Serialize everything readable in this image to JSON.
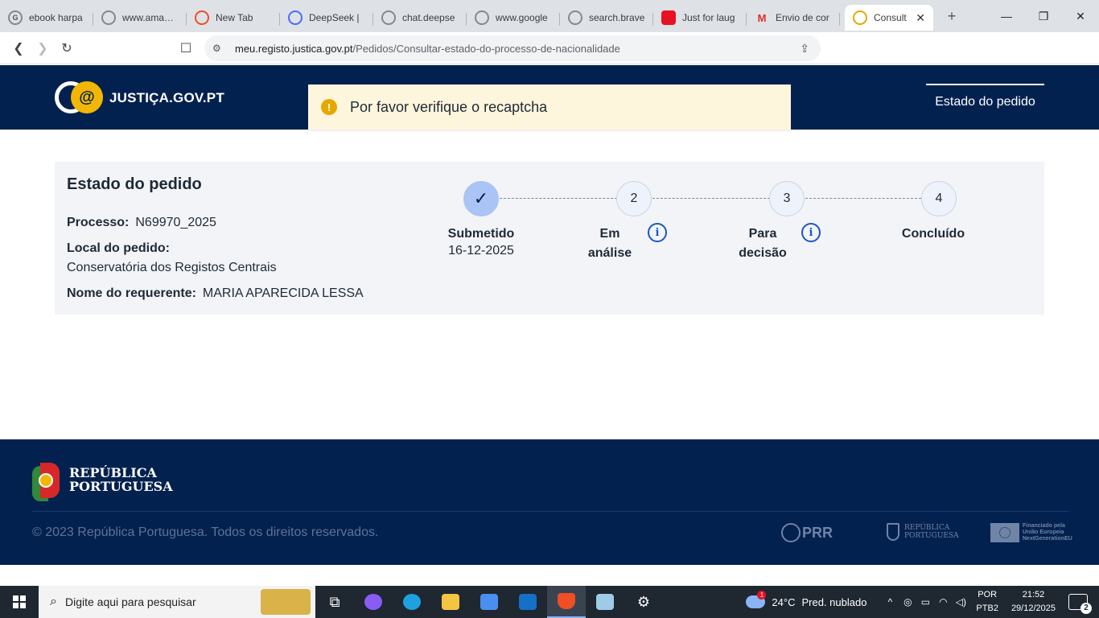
{
  "browser": {
    "tabs": [
      {
        "label": "ebook harpa",
        "icon": "google-icon"
      },
      {
        "label": "www.amazon",
        "icon": "globe-icon"
      },
      {
        "label": "New Tab",
        "icon": "brave-icon"
      },
      {
        "label": "DeepSeek |",
        "icon": "deepseek-icon"
      },
      {
        "label": "chat.deepse",
        "icon": "globe-icon"
      },
      {
        "label": "www.google",
        "icon": "globe-icon"
      },
      {
        "label": "search.brave",
        "icon": "globe-icon"
      },
      {
        "label": "Just for laug",
        "icon": "youtube-icon"
      },
      {
        "label": "Envio de cor",
        "icon": "gmail-icon"
      }
    ],
    "active_tab": {
      "label": "Consult",
      "icon": "justica-icon"
    },
    "url_domain": "meu.registo.justica.gov.pt",
    "url_path": "/Pedidos/Consultar-estado-do-processo-de-nacionalidade"
  },
  "site": {
    "logo_text": "JUSTIÇA.GOV.PT",
    "logo_symbol": "@",
    "nav_item": "Estado do pedido"
  },
  "alert": {
    "icon": "!",
    "message": "Por favor verifique o recaptcha"
  },
  "status": {
    "title": "Estado do pedido",
    "processo_label": "Processo:",
    "processo_value": "N69970_2025",
    "local_label": "Local do pedido:",
    "local_value": "Conservatória dos Registos Centrais",
    "nome_label": "Nome do requerente:",
    "nome_value": "MARIA APARECIDA LESSA",
    "steps": [
      {
        "number": "✓",
        "label": "Submetido",
        "date": "16-12-2025",
        "done": true
      },
      {
        "number": "2",
        "label": "Em análise",
        "info": true
      },
      {
        "number": "3",
        "label": "Para decisão",
        "info": true
      },
      {
        "number": "4",
        "label": "Concluído"
      }
    ]
  },
  "footer": {
    "rep_line1": "REPÚBLICA",
    "rep_line2": "PORTUGUESA",
    "copyright": "© 2023 República Portuguesa. Todos os direitos reservados.",
    "prr": "PRR",
    "rp_small_line1": "REPÚBLICA",
    "rp_small_line2": "PORTUGUESA",
    "eu_line1": "Financiado pela",
    "eu_line2": "União Europeia",
    "eu_line3": "NextGenerationEU"
  },
  "taskbar": {
    "search_placeholder": "Digite aqui para pesquisar",
    "weather_temp": "24°C",
    "weather_desc": "Pred. nublado",
    "weather_badge": "1",
    "lang_line1": "POR",
    "lang_line2": "PTB2",
    "time": "21:52",
    "date": "29/12/2025",
    "notifications": "2"
  },
  "colors": {
    "header_bg": "#03214f",
    "alert_bg": "#fef6dc",
    "alert_icon": "#e6a800",
    "step_done": "#a9c4f5",
    "info_blue": "#1a56c4"
  }
}
